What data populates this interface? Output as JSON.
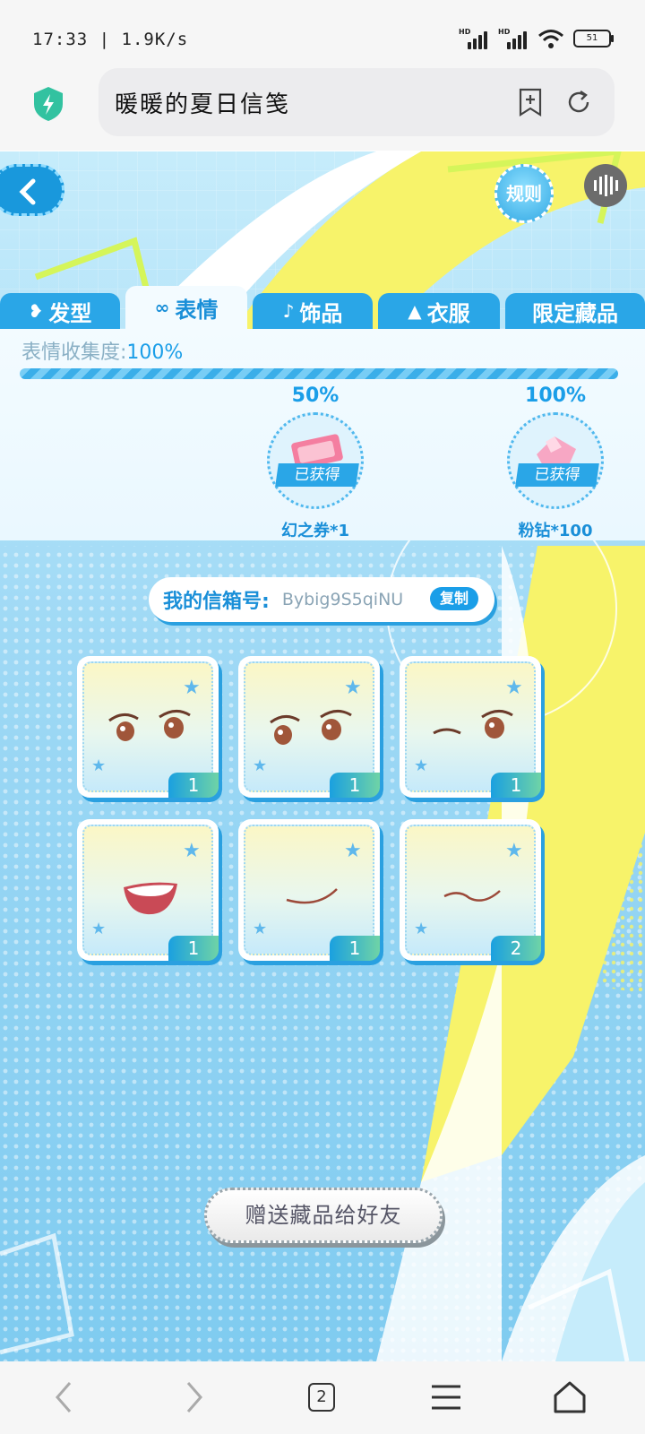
{
  "status": {
    "time": "17:33",
    "speed": "1.9K/s",
    "network_left": "HD",
    "network_right": "HD",
    "battery": "51"
  },
  "browser": {
    "title": "暖暖的夏日信笺",
    "tab_count": "2"
  },
  "game": {
    "rules_label": "规则",
    "tabs": [
      {
        "label": "发型",
        "icon": "hair-icon",
        "active": false
      },
      {
        "label": "表情",
        "icon": "mask-icon",
        "active": true
      },
      {
        "label": "饰品",
        "icon": "accessory-icon",
        "active": false
      },
      {
        "label": "衣服",
        "icon": "clothes-icon",
        "active": false
      },
      {
        "label": "限定藏品",
        "icon": "",
        "active": false
      }
    ],
    "collection": {
      "label": "表情收集度:",
      "percent": "100%",
      "progress_value": 1.0,
      "milestones": [
        {
          "percent": "50%",
          "status": "已获得",
          "reward": "幻之券*1"
        },
        {
          "percent": "100%",
          "status": "已获得",
          "reward": "粉钻*100"
        }
      ]
    },
    "mailbox": {
      "label": "我的信箱号:",
      "value": "Bybig9S5qiNU",
      "copy_label": "复制"
    },
    "items": [
      {
        "type": "eyes-normal",
        "count": "1"
      },
      {
        "type": "eyes-look",
        "count": "1"
      },
      {
        "type": "eyes-wink",
        "count": "1"
      },
      {
        "type": "mouth-open",
        "count": "1"
      },
      {
        "type": "mouth-smile",
        "count": "1"
      },
      {
        "type": "mouth-wavy",
        "count": "2"
      }
    ],
    "gift_label": "赠送藏品给好友"
  },
  "colors": {
    "accent": "#1a9ee8",
    "tab": "#2aa6e7",
    "yellow": "#f7f36a"
  }
}
